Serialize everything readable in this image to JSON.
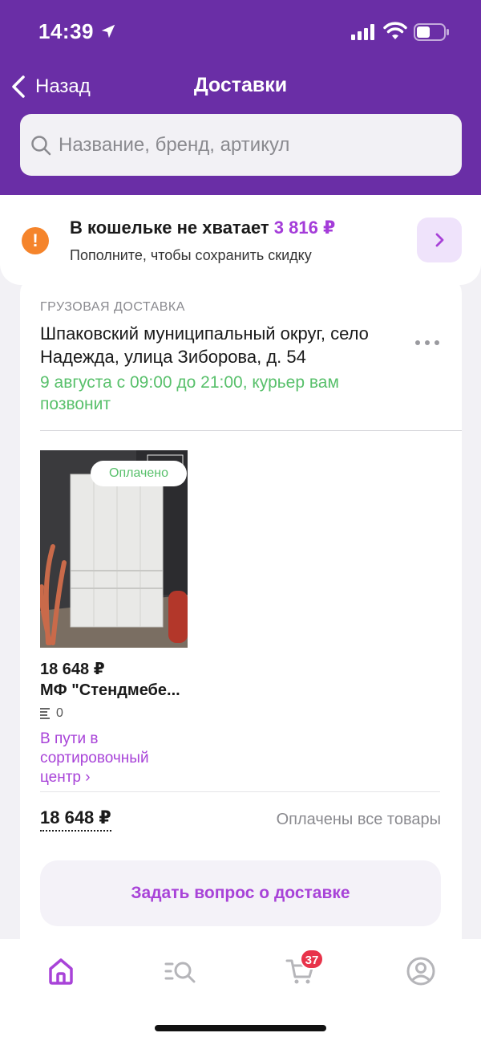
{
  "status_bar": {
    "time": "14:39"
  },
  "nav": {
    "back_label": "Назад",
    "title": "Доставки"
  },
  "search": {
    "placeholder": "Название, бренд, артикул"
  },
  "wallet": {
    "title_prefix": "В кошельке не хватает",
    "amount": "3 816 ₽",
    "subtitle": "Пополните, чтобы сохранить скидку"
  },
  "delivery": {
    "type_label": "ГРУЗОВАЯ ДОСТАВКА",
    "address": "Шпаковский муниципальный округ, село Надежда, улица Зиборова, д. 54",
    "time_text": "9 августа с 09:00 до 21:00, курьер вам позвонит",
    "product": {
      "paid_badge": "Оплачено",
      "price": "18 648 ₽",
      "name": "МФ \"Стендмебе...",
      "quantity": "0",
      "status": "В пути в сортировочный центр ›"
    },
    "total": "18 648 ₽",
    "total_status": "Оплачены все товары",
    "question_button": "Задать вопрос о доставке"
  },
  "tab_bar": {
    "cart_count": "37"
  },
  "colors": {
    "brand": "#6a2ea6",
    "accent": "#a843d8",
    "success": "#58c06b",
    "warning": "#f5842b",
    "badge": "#e8334a"
  },
  "icons": [
    "location-arrow-icon",
    "signal-icon",
    "wifi-icon",
    "battery-icon",
    "chevron-left-icon",
    "search-icon",
    "warning-icon",
    "chevron-right-icon",
    "more-dots-icon",
    "list-icon",
    "home-icon",
    "catalog-search-icon",
    "cart-icon",
    "profile-icon"
  ]
}
